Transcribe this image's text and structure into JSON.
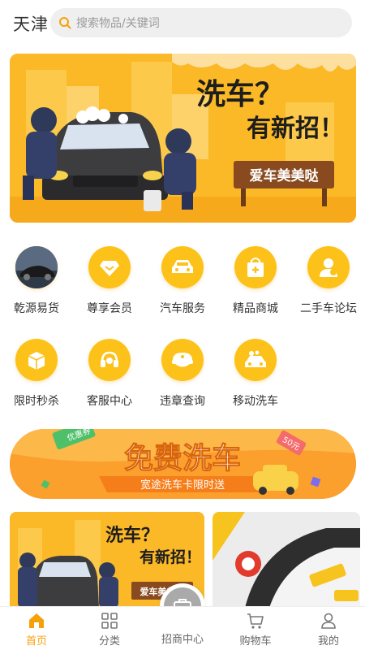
{
  "header": {
    "city": "天津",
    "search_placeholder": "搜索物品/关键词"
  },
  "banner": {
    "headline1": "洗车？",
    "headline2": "有新招！",
    "sign": "爱车美美哒"
  },
  "grid": {
    "items": [
      {
        "label": "乾源易货",
        "icon": "car-photo-icon"
      },
      {
        "label": "尊享会员",
        "icon": "diamond-icon"
      },
      {
        "label": "汽车服务",
        "icon": "car-icon"
      },
      {
        "label": "精品商城",
        "icon": "shopping-bag-icon"
      },
      {
        "label": "二手车论坛",
        "icon": "person-icon"
      },
      {
        "label": "限时秒杀",
        "icon": "box-icon"
      },
      {
        "label": "客服中心",
        "icon": "headset-icon"
      },
      {
        "label": "违章查询",
        "icon": "police-cap-icon"
      },
      {
        "label": "移动洗车",
        "icon": "car-wash-icon"
      }
    ]
  },
  "promo": {
    "title": "免费洗车",
    "subtitle": "宽途洗车卡限时送",
    "tag_left": "优惠券",
    "tag_right": "50元"
  },
  "card1": {
    "headline1": "洗车？",
    "headline2": "有新招！",
    "sign": "爱车美美哒"
  },
  "tabbar": {
    "tabs": [
      {
        "label": "首页",
        "icon": "home-icon"
      },
      {
        "label": "分类",
        "icon": "grid-icon"
      },
      {
        "label": "招商中心",
        "icon": "briefcase-icon"
      },
      {
        "label": "购物车",
        "icon": "cart-icon"
      },
      {
        "label": "我的",
        "icon": "user-icon"
      }
    ]
  },
  "colors": {
    "accent": "#f5a20a",
    "icon_yellow": "#fcc21a",
    "banner_bg": "#fbb928"
  }
}
